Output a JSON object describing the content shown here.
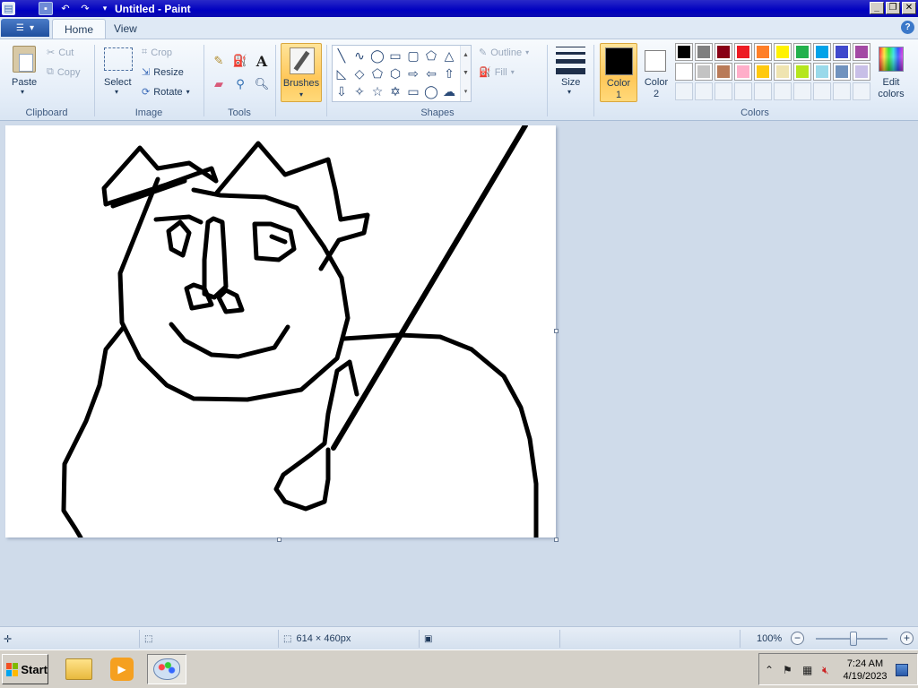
{
  "window": {
    "title": "Untitled - Paint"
  },
  "tabs": [
    {
      "label": "Home",
      "active": true
    },
    {
      "label": "View",
      "active": false
    }
  ],
  "help_icon": "?",
  "ribbon": {
    "clipboard": {
      "label": "Clipboard",
      "paste": "Paste",
      "cut": "Cut",
      "copy": "Copy"
    },
    "image": {
      "label": "Image",
      "select": "Select",
      "crop": "Crop",
      "resize": "Resize",
      "rotate": "Rotate"
    },
    "tools": {
      "label": "Tools",
      "text_tool": "A"
    },
    "brushes": {
      "label": "Brushes"
    },
    "shapes": {
      "label": "Shapes",
      "outline": "Outline",
      "fill": "Fill"
    },
    "size": {
      "label": "Size"
    },
    "colors": {
      "label": "Colors",
      "color1_label": "Color\n1",
      "color1_line1": "Color",
      "color1_line2": "1",
      "color2_line1": "Color",
      "color2_line2": "2",
      "color1_value": "#000000",
      "color2_value": "#ffffff",
      "edit_line1": "Edit",
      "edit_line2": "colors",
      "palette": [
        "#000000",
        "#7f7f7f",
        "#880015",
        "#ed1c24",
        "#ff7f27",
        "#fff200",
        "#22b14c",
        "#00a2e8",
        "#3f48cc",
        "#a349a4",
        "#ffffff",
        "#c3c3c3",
        "#b97a57",
        "#ffaec9",
        "#ffc90e",
        "#efe4b0",
        "#b5e61d",
        "#99d9ea",
        "#7092be",
        "#c8bfe7"
      ]
    }
  },
  "statusbar": {
    "dimensions": "614 × 460px",
    "zoom": "100%"
  },
  "taskbar": {
    "start": "Start",
    "time": "7:24 AM",
    "date": "4/19/2023"
  },
  "icons": {
    "app": "paint-app-icon",
    "save": "save-icon",
    "undo": "undo-icon",
    "redo": "redo-icon",
    "paste": "clipboard-icon",
    "cut": "scissors-icon",
    "copy": "copy-icon",
    "select": "selection-icon",
    "crop": "crop-icon",
    "resize": "resize-icon",
    "rotate": "rotate-icon",
    "pencil": "pencil-icon",
    "fill": "paint-bucket-icon",
    "text": "text-icon",
    "eraser": "eraser-icon",
    "picker": "color-picker-icon",
    "magnifier": "magnifier-icon"
  }
}
